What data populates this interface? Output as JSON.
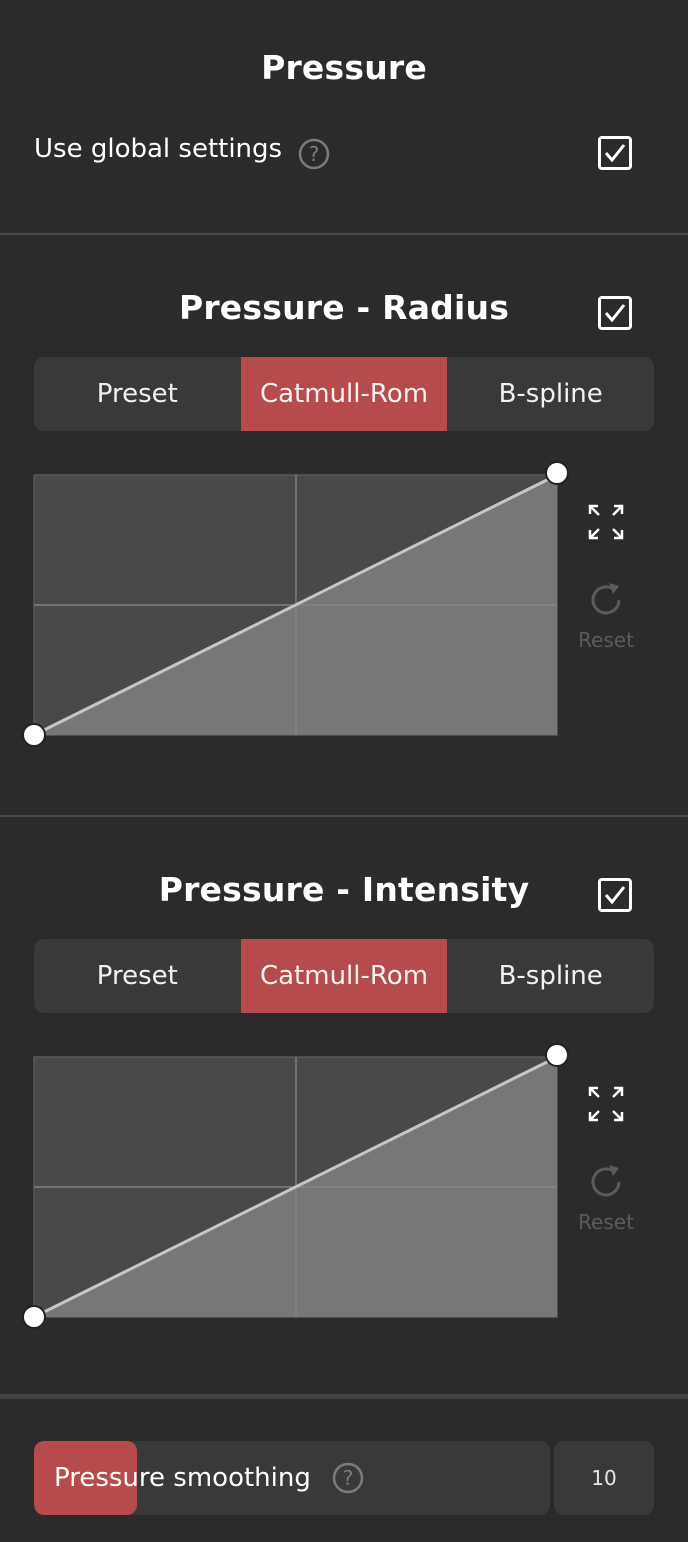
{
  "header": {
    "title": "Pressure",
    "use_global_label": "Use global settings",
    "use_global_checked": true
  },
  "curves": [
    {
      "title": "Pressure - Radius",
      "enabled": true,
      "modes": [
        "Preset",
        "Catmull-Rom",
        "B-spline"
      ],
      "active_mode": "Catmull-Rom",
      "reset_label": "Reset",
      "points": [
        [
          0,
          0
        ],
        [
          1,
          1
        ]
      ]
    },
    {
      "title": "Pressure - Intensity",
      "enabled": true,
      "modes": [
        "Preset",
        "Catmull-Rom",
        "B-spline"
      ],
      "active_mode": "Catmull-Rom",
      "reset_label": "Reset",
      "points": [
        [
          0,
          0
        ],
        [
          1,
          1
        ]
      ]
    }
  ],
  "smoothing": {
    "label": "Pressure smoothing",
    "value": "10",
    "fraction": 0.2
  },
  "colors": {
    "background": "#2c2a2b",
    "accent": "#b54b4d",
    "control_bg": "#3a3839"
  }
}
